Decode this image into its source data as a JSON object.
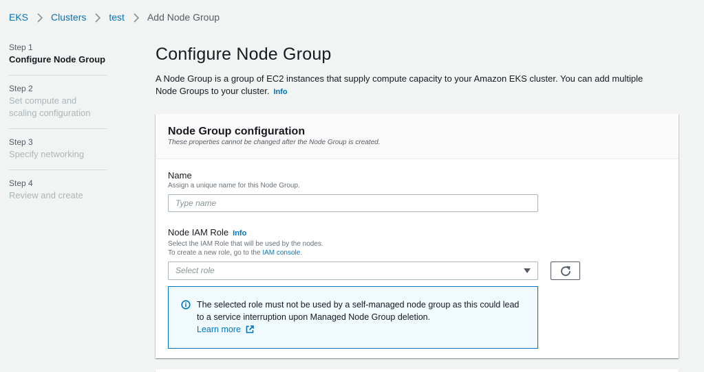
{
  "breadcrumb": {
    "items": [
      {
        "label": "EKS"
      },
      {
        "label": "Clusters"
      },
      {
        "label": "test"
      }
    ],
    "current": "Add Node Group"
  },
  "steps": [
    {
      "number": "Step 1",
      "title": "Configure Node Group",
      "active": true
    },
    {
      "number": "Step 2",
      "title": "Set compute and scaling configuration",
      "active": false
    },
    {
      "number": "Step 3",
      "title": "Specify networking",
      "active": false
    },
    {
      "number": "Step 4",
      "title": "Review and create",
      "active": false
    }
  ],
  "page": {
    "title": "Configure Node Group",
    "description": "A Node Group is a group of EC2 instances that supply compute capacity to your Amazon EKS cluster. You can add multiple Node Groups to your cluster.",
    "info_label": "Info"
  },
  "card": {
    "title": "Node Group configuration",
    "subtitle": "These properties cannot be changed after the Node Group is created.",
    "name_field": {
      "label": "Name",
      "description": "Assign a unique name for this Node Group.",
      "placeholder": "Type name",
      "value": ""
    },
    "role_field": {
      "label": "Node IAM Role",
      "info_label": "Info",
      "description_line1": "Select the IAM Role that will be used by the nodes.",
      "description_line2_prefix": "To create a new role, go to the ",
      "description_link": "IAM console",
      "description_line2_suffix": ".",
      "placeholder": "Select role"
    },
    "alert": {
      "text": "The selected role must not be used by a self-managed node group as this could lead to a service interruption upon Managed Node Group deletion.",
      "link_label": "Learn more"
    }
  },
  "colors": {
    "link": "#0073bb",
    "background": "#f2f3f3",
    "alert_bg": "#f1faff",
    "alert_border": "#0073bb"
  }
}
